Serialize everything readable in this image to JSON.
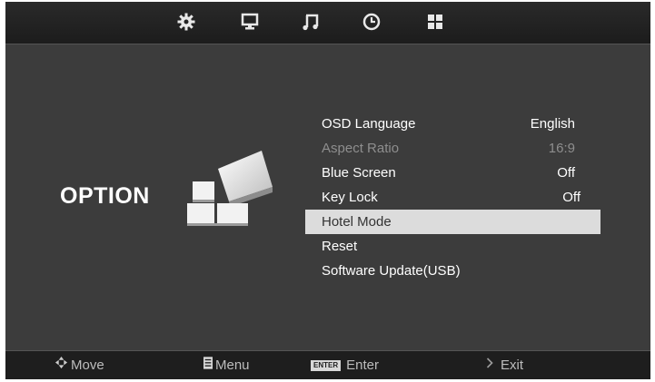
{
  "top_tabs": [
    {
      "icon": "gear-icon"
    },
    {
      "icon": "monitor-icon"
    },
    {
      "icon": "music-note-icon"
    },
    {
      "icon": "clock-icon"
    },
    {
      "icon": "grid-icon"
    }
  ],
  "page": {
    "title": "OPTION",
    "graphic_icon": "option-blocks-icon"
  },
  "menu": {
    "items": [
      {
        "label": "OSD Language",
        "value": "English",
        "state": "normal"
      },
      {
        "label": "Aspect Ratio",
        "value": "16:9",
        "state": "disabled"
      },
      {
        "label": "Blue Screen",
        "value": "Off",
        "state": "normal"
      },
      {
        "label": "Key Lock",
        "value": "Off",
        "state": "normal"
      },
      {
        "label": "Hotel Mode",
        "value": "",
        "state": "selected"
      },
      {
        "label": "Reset",
        "value": "",
        "state": "normal"
      },
      {
        "label": "Software Update(USB)",
        "value": "",
        "state": "normal"
      }
    ]
  },
  "footer": {
    "move": {
      "icon": "dpad-icon",
      "label": "Move"
    },
    "menu": {
      "icon": "menu-key-icon",
      "label": "Menu"
    },
    "enter": {
      "key": "ENTER",
      "label": "Enter"
    },
    "exit": {
      "icon": "exit-icon",
      "label": "Exit"
    }
  },
  "colors": {
    "background": "#3c3c3c",
    "selected_row": "#dcdcdc",
    "disabled_text": "#8e8e8e",
    "text": "#ffffff"
  }
}
